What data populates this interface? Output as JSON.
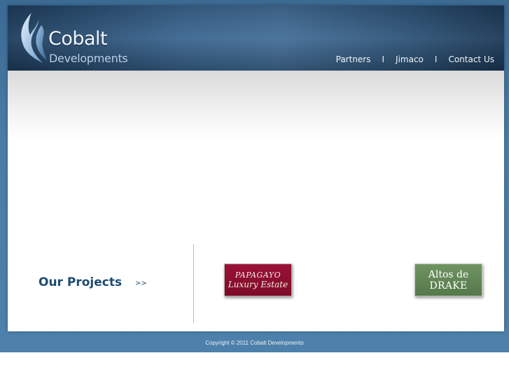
{
  "brand": {
    "name": "Cobalt",
    "subtitle": "Developments"
  },
  "nav": {
    "items": [
      {
        "label": "Partners"
      },
      {
        "label": "Jimaco"
      },
      {
        "label": "Contact Us"
      }
    ],
    "separator": "I"
  },
  "projects": {
    "title": "Our Projects",
    "arrow": ">>",
    "items": [
      {
        "line1": "PAPAGAYO",
        "line2": "Luxury Estate",
        "color": "#8a0f2f"
      },
      {
        "line1": "Altos de",
        "line2": "DRAKE",
        "color": "#628856"
      }
    ]
  },
  "footer": {
    "copyright": "Copyright © 2011 Cobalt Developments"
  },
  "colors": {
    "page_background": "#4a7ca6",
    "header_dark": "#1e3e5e",
    "accent_text": "#1c4b70"
  },
  "icons": {
    "logo": "flame-swirl-icon"
  }
}
